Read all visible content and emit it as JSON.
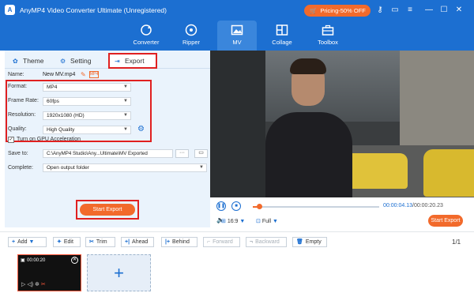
{
  "app": {
    "title": "AnyMP4 Video Converter Ultimate (Unregistered)",
    "pricing_label": "Pricing-50% OFF"
  },
  "nav": {
    "items": [
      {
        "label": "Converter",
        "icon": "refresh-icon"
      },
      {
        "label": "Ripper",
        "icon": "disc-icon"
      },
      {
        "label": "MV",
        "icon": "image-icon",
        "active": true
      },
      {
        "label": "Collage",
        "icon": "grid-icon"
      },
      {
        "label": "Toolbox",
        "icon": "toolbox-icon"
      }
    ]
  },
  "tabs": {
    "theme": "Theme",
    "setting": "Setting",
    "export": "Export"
  },
  "export": {
    "name_label": "Name:",
    "name_value": "New MV.mp4",
    "format_label": "Format:",
    "format_value": "MP4",
    "framerate_label": "Frame Rate:",
    "framerate_value": "60fps",
    "resolution_label": "Resolution:",
    "resolution_value": "1920x1080 (HD)",
    "quality_label": "Quality:",
    "quality_value": "High Quality",
    "gpu_label": "Turn on GPU Acceleration",
    "gpu_checked": true,
    "saveto_label": "Save to:",
    "saveto_value": "C:\\AnyMP4 Studio\\Any...Ultimate\\MV Exported",
    "saveto_more": "···",
    "complete_label": "Complete:",
    "complete_value": "Open output folder",
    "start_export": "Start Export"
  },
  "player": {
    "current_time": "00:00:04.13",
    "total_time": "00:00:20.23",
    "progress_fraction": 0.05,
    "aspect_ratio": "16:9",
    "view_mode": "Full",
    "start_export": "Start Export"
  },
  "timeline": {
    "add": "Add",
    "edit": "Edit",
    "trim": "Trim",
    "ahead": "Ahead",
    "behind": "Behind",
    "forward": "Forward",
    "backward": "Backward",
    "empty": "Empty",
    "page": "1/1",
    "clip_duration": "00:00:20"
  },
  "colors": {
    "brand_blue": "#1c6fd1",
    "accent_orange": "#f26a2b",
    "highlight_red": "#e02020"
  }
}
